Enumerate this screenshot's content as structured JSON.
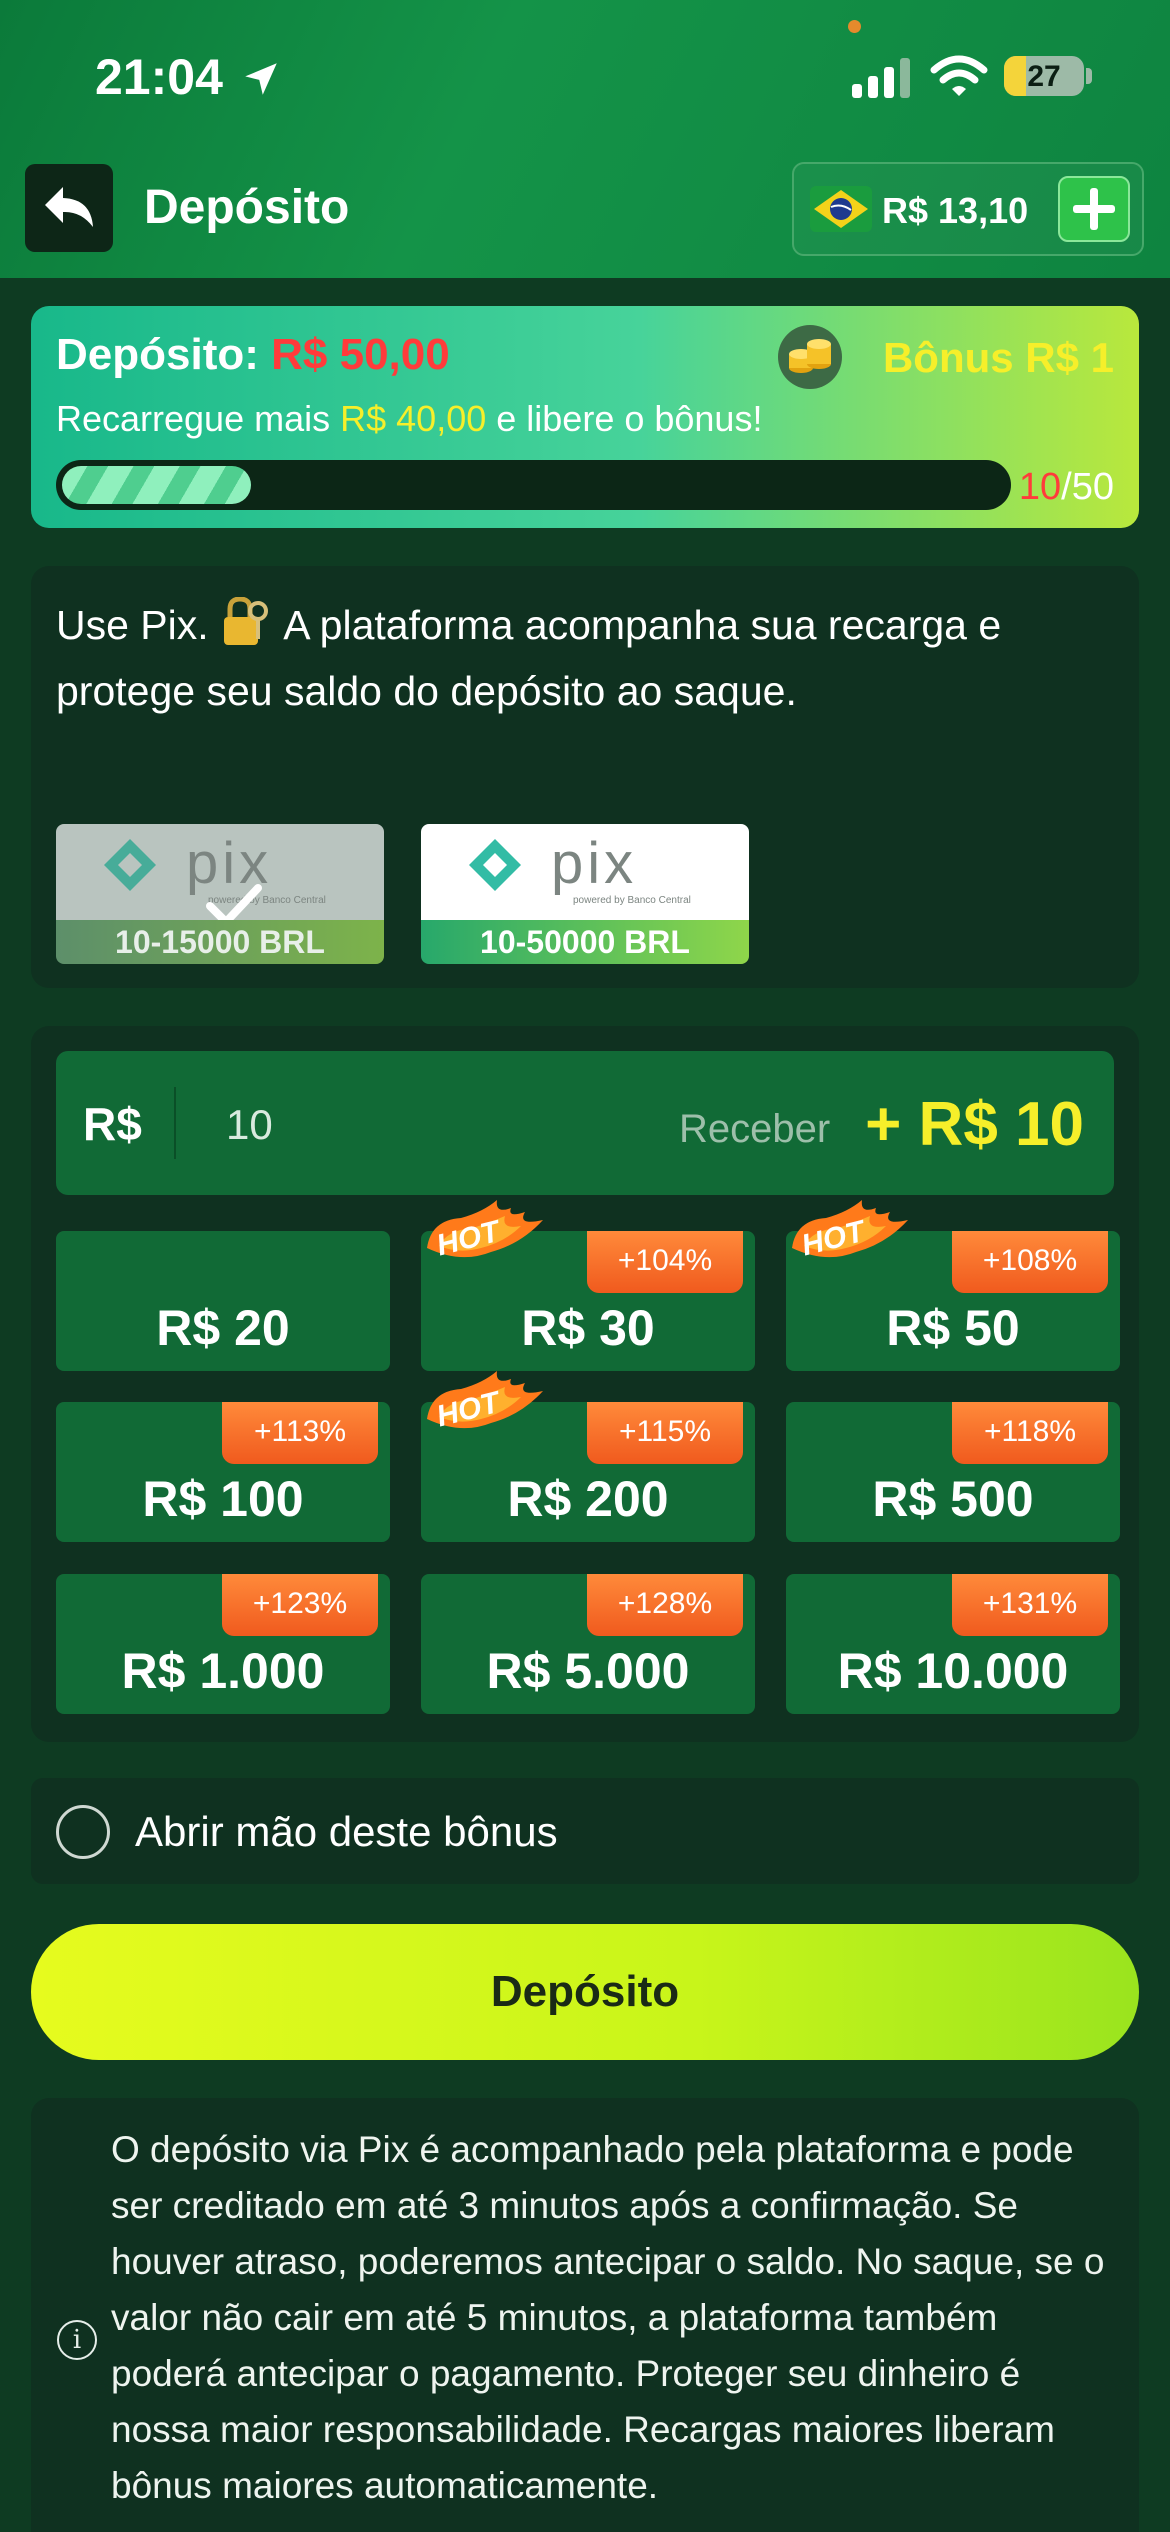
{
  "status": {
    "time": "21:04",
    "battery": "27",
    "battery_level": 0.27
  },
  "header": {
    "title": "Depósito",
    "balance": "R$ 13,10"
  },
  "bonus": {
    "deposit_label": "Depósito:",
    "deposit_value": "R$ 50,00",
    "bonus_label": "Bônus R$ 1",
    "recharge_prefix": "Recarregue mais",
    "recharge_value": "R$ 40,00",
    "recharge_suffix": "e libere o bônus!",
    "progress_current": "10",
    "progress_total": "/50",
    "progress_fraction": 0.2
  },
  "pix": {
    "description_prefix": "Use Pix.",
    "description_suffix": "A plataforma acompanha sua recarga e protege seu saldo do depósito ao saque.",
    "options": [
      {
        "range": "10-15000 BRL",
        "selected": true
      },
      {
        "range": "10-50000 BRL",
        "selected": false
      }
    ]
  },
  "amount": {
    "currency": "R$",
    "value": "10",
    "receive_label": "Receber",
    "receive_value": "+ R$ 10",
    "hot_label": "HOT",
    "options": [
      {
        "label": "R$ 20",
        "badge": "",
        "hot": false
      },
      {
        "label": "R$ 30",
        "badge": "+104%",
        "hot": true
      },
      {
        "label": "R$ 50",
        "badge": "+108%",
        "hot": true
      },
      {
        "label": "R$ 100",
        "badge": "+113%",
        "hot": false
      },
      {
        "label": "R$ 200",
        "badge": "+115%",
        "hot": true
      },
      {
        "label": "R$ 500",
        "badge": "+118%",
        "hot": false
      },
      {
        "label": "R$ 1.000",
        "badge": "+123%",
        "hot": false
      },
      {
        "label": "R$ 5.000",
        "badge": "+128%",
        "hot": false
      },
      {
        "label": "R$ 10.000",
        "badge": "+131%",
        "hot": false
      }
    ]
  },
  "optout": {
    "label": "Abrir mão deste bônus"
  },
  "deposit_button": {
    "label": "Depósito"
  },
  "info": {
    "text": "O depósito via Pix é acompanhado pela plataforma e pode ser creditado em até 3 minutos após a confirmação. Se houver atraso, poderemos antecipar o saldo. No saque, se o valor não cair em até 5 minutos, a plataforma também poderá antecipar o pagamento. Proteger seu dinheiro é nossa maior responsabilidade. Recargas maiores liberam bônus maiores automaticamente."
  },
  "colors": {
    "accent_yellow": "#f6ef2a",
    "accent_red": "#ff3b3b",
    "green_dark": "#0f3120",
    "green_button": "#116a36"
  }
}
